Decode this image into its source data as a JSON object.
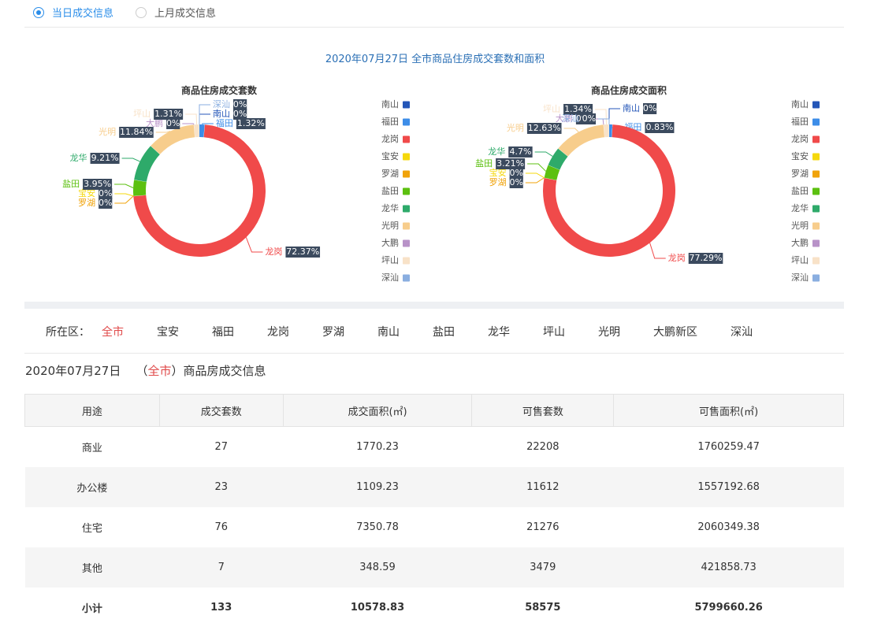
{
  "tabs": [
    {
      "label": "当日成交信息",
      "checked": true
    },
    {
      "label": "上月成交信息",
      "checked": false
    }
  ],
  "main_title": "2020年07月27日 全市商品住房成交套数和面积",
  "colors": {
    "南山": "#2456b8",
    "福田": "#3d8de8",
    "龙岗": "#f04a4a",
    "宝安": "#f5d80c",
    "罗湖": "#f0a30a",
    "盐田": "#5cc010",
    "龙华": "#2eaa6a",
    "光明": "#f7cd8c",
    "大鹏": "#b892c8",
    "坪山": "#f8e2c8",
    "深汕": "#8aaee0"
  },
  "chart_data": [
    {
      "type": "pie",
      "title": "商品住房成交套数",
      "labels": [
        "南山",
        "福田",
        "龙岗",
        "宝安",
        "罗湖",
        "盐田",
        "龙华",
        "光明",
        "大鹏",
        "坪山",
        "深汕"
      ],
      "values": [
        0,
        1.32,
        72.37,
        0,
        0,
        3.95,
        9.21,
        11.84,
        0,
        1.31,
        0
      ],
      "value_labels": [
        "0%",
        "1.32%",
        "72.37%",
        "0%",
        "0%",
        "3.95%",
        "9.21%",
        "11.84%",
        "0%",
        "1.31%",
        "0%"
      ],
      "legend": [
        "南山",
        "福田",
        "龙岗",
        "宝安",
        "罗湖",
        "盐田",
        "龙华",
        "光明",
        "大鹏",
        "坪山",
        "深汕"
      ]
    },
    {
      "type": "pie",
      "title": "商品住房成交面积",
      "labels": [
        "南山",
        "福田",
        "龙岗",
        "宝安",
        "罗湖",
        "盐田",
        "龙华",
        "光明",
        "大鹏",
        "坪山",
        "深汕"
      ],
      "values": [
        0,
        0.83,
        77.29,
        0,
        0,
        3.21,
        4.7,
        12.63,
        0,
        1.34,
        0
      ],
      "value_labels": [
        "0%",
        "0.83%",
        "77.29%",
        "0%",
        "0%",
        "3.21%",
        "4.7%",
        "12.63%",
        "0%",
        "1.34%",
        "0%"
      ],
      "legend": [
        "南山",
        "福田",
        "龙岗",
        "宝安",
        "罗湖",
        "盐田",
        "龙华",
        "光明",
        "大鹏",
        "坪山",
        "深汕"
      ]
    }
  ],
  "district_filter": {
    "label": "所在区：",
    "options": [
      "全市",
      "宝安",
      "福田",
      "龙岗",
      "罗湖",
      "南山",
      "盐田",
      "龙华",
      "坪山",
      "光明",
      "大鹏新区",
      "深汕"
    ],
    "active": "全市"
  },
  "info": {
    "date": "2020年07月27日",
    "open_paren": "（",
    "region": "全市",
    "close_paren": "）",
    "suffix": "商品房成交信息"
  },
  "table": {
    "headers": [
      "用途",
      "成交套数",
      "成交面积(㎡)",
      "可售套数",
      "可售面积(㎡)"
    ],
    "rows": [
      [
        "商业",
        "27",
        "1770.23",
        "22208",
        "1760259.47"
      ],
      [
        "办公楼",
        "23",
        "1109.23",
        "11612",
        "1557192.68"
      ],
      [
        "住宅",
        "76",
        "7350.78",
        "21276",
        "2060349.38"
      ],
      [
        "其他",
        "7",
        "348.59",
        "3479",
        "421858.73"
      ]
    ],
    "total": [
      "小计",
      "133",
      "10578.83",
      "58575",
      "5799660.26"
    ]
  }
}
